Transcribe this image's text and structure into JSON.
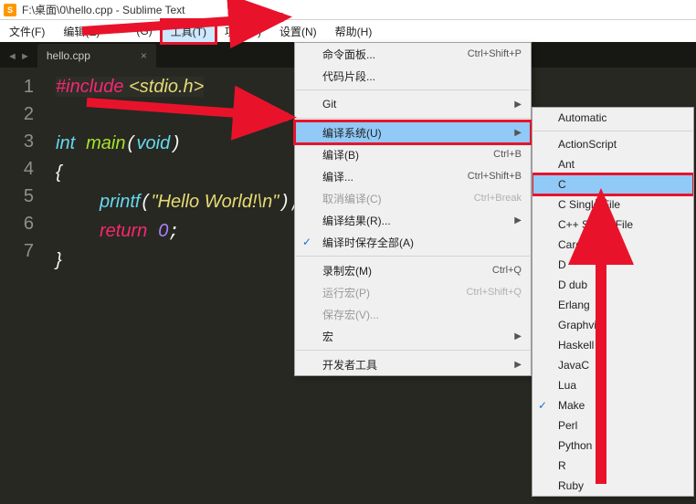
{
  "window_title": "F:\\桌面\\0\\hello.cpp - Sublime Text",
  "menubar": {
    "items": [
      "文件(F)",
      "编辑(E)",
      "",
      "(G)",
      "工具(T)",
      "项目(P)",
      "设置(N)",
      "帮助(H)"
    ],
    "active_index": 4
  },
  "tab": {
    "name": "hello.cpp",
    "close": "×"
  },
  "nav_arrows": "◄  ►",
  "gutter_lines": [
    "1",
    "2",
    "3",
    "4",
    "5",
    "6",
    "7"
  ],
  "code": {
    "l1_include": "#include",
    "l1_path": "<stdio.h>",
    "l3_int": "int",
    "l3_main": "main",
    "l3_void": "void",
    "l4_brace": "{",
    "l5_printf": "printf",
    "l5_str": "\"Hello World!\\n\"",
    "l6_return": "return",
    "l6_zero": "0",
    "l7_brace": "}"
  },
  "tools_menu": {
    "items": [
      {
        "label": "命令面板...",
        "shortcut": "Ctrl+Shift+P"
      },
      {
        "label": "代码片段..."
      },
      {
        "sep": true
      },
      {
        "label": "Git",
        "sub": true
      },
      {
        "sep": true
      },
      {
        "label": "编译系统(U)",
        "sub": true,
        "hover": true,
        "highlight": true
      },
      {
        "label": "编译(B)",
        "shortcut": "Ctrl+B"
      },
      {
        "label": "编译...",
        "shortcut": "Ctrl+Shift+B"
      },
      {
        "label": "取消编译(C)",
        "shortcut": "Ctrl+Break",
        "disabled": true
      },
      {
        "label": "编译结果(R)...",
        "sub": true
      },
      {
        "label": "编译时保存全部(A)",
        "checked": true
      },
      {
        "sep": true
      },
      {
        "label": "录制宏(M)",
        "shortcut": "Ctrl+Q"
      },
      {
        "label": "运行宏(P)",
        "shortcut": "Ctrl+Shift+Q",
        "disabled": true
      },
      {
        "label": "保存宏(V)...",
        "disabled": true
      },
      {
        "label": "宏",
        "sub": true
      },
      {
        "sep": true
      },
      {
        "label": "开发者工具",
        "sub": true
      }
    ]
  },
  "build_submenu": {
    "items": [
      {
        "label": "Automatic"
      },
      {
        "sep": true
      },
      {
        "label": "ActionScript"
      },
      {
        "label": "Ant"
      },
      {
        "label": "C",
        "hover": true,
        "highlight": true
      },
      {
        "label": "C Single File"
      },
      {
        "label": "C++ Single File"
      },
      {
        "label": "Cargo"
      },
      {
        "label": "D"
      },
      {
        "label": "D dub"
      },
      {
        "label": "Erlang"
      },
      {
        "label": "Graphviz"
      },
      {
        "label": "Haskell"
      },
      {
        "label": "JavaC"
      },
      {
        "label": "Lua"
      },
      {
        "label": "Make",
        "checked": true
      },
      {
        "label": "Perl"
      },
      {
        "label": "Python"
      },
      {
        "label": "R"
      },
      {
        "label": "Ruby"
      }
    ]
  }
}
